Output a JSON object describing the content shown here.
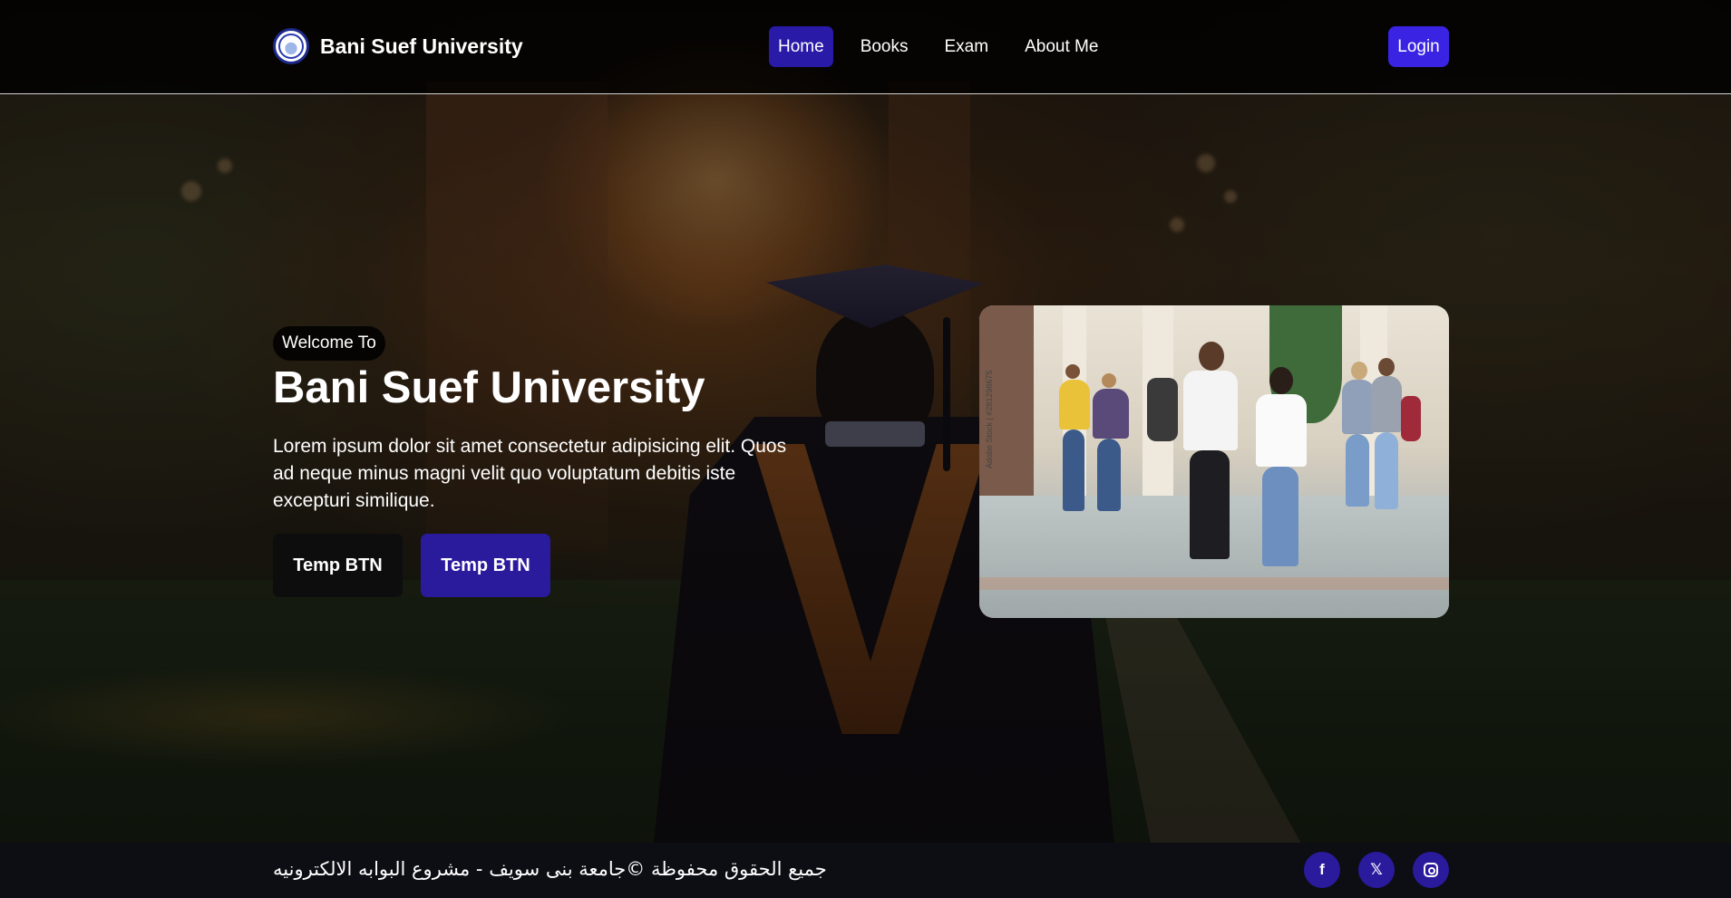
{
  "navbar": {
    "brand_name": "Bani Suef University",
    "links": [
      {
        "label": "Home",
        "active": true
      },
      {
        "label": "Books",
        "active": false
      },
      {
        "label": "Exam",
        "active": false
      },
      {
        "label": "About Me",
        "active": false
      }
    ],
    "login_label": "Login"
  },
  "hero": {
    "badge": "Welcome To",
    "title": "Bani Suef University",
    "description": "Lorem ipsum dolor sit amet consectetur adipisicing elit. Quos ad neque minus magni velit quo voluptatum debitis iste excepturi similique.",
    "buttons": [
      {
        "label": "Temp BTN"
      },
      {
        "label": "Temp BTN"
      }
    ],
    "photo_watermark": "Adobe Stock | #281298675"
  },
  "footer": {
    "copyright": "جميع الحقوق محفوظة ©جامعة بنى سويف - مشروع البوابه الالكترونيه",
    "social": [
      {
        "icon": "facebook-icon",
        "glyph": "f"
      },
      {
        "icon": "x-icon",
        "glyph": "𝕏"
      },
      {
        "icon": "instagram-icon",
        "glyph": ""
      }
    ]
  },
  "colors": {
    "accent": "#3a23e3",
    "nav_active": "#2a1aa8",
    "button_primary": "#2a1a9c",
    "footer_bg": "#0d0d14"
  }
}
